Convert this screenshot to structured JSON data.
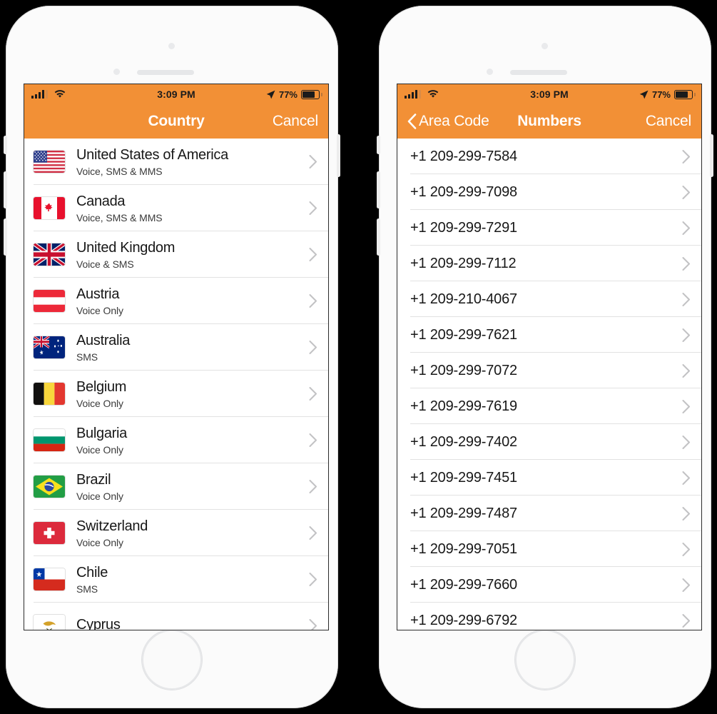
{
  "background_color": "#000000",
  "accent_color": "#f29036",
  "status_bar": {
    "time": "3:09 PM",
    "battery_percent": "77%",
    "signal_icon": "cellular-signal-icon",
    "wifi_icon": "wifi-icon",
    "location_icon": "location-arrow-icon",
    "battery_icon": "battery-icon"
  },
  "left_phone": {
    "nav": {
      "title": "Country",
      "right_label": "Cancel",
      "back_label": ""
    },
    "rows": [
      {
        "flag": "us",
        "name": "United States of America",
        "services": "Voice, SMS & MMS"
      },
      {
        "flag": "ca",
        "name": "Canada",
        "services": "Voice, SMS & MMS"
      },
      {
        "flag": "gb",
        "name": "United Kingdom",
        "services": "Voice & SMS"
      },
      {
        "flag": "at",
        "name": "Austria",
        "services": "Voice Only"
      },
      {
        "flag": "au",
        "name": "Australia",
        "services": "SMS"
      },
      {
        "flag": "be",
        "name": "Belgium",
        "services": "Voice Only"
      },
      {
        "flag": "bg",
        "name": "Bulgaria",
        "services": "Voice Only"
      },
      {
        "flag": "br",
        "name": "Brazil",
        "services": "Voice Only"
      },
      {
        "flag": "ch",
        "name": "Switzerland",
        "services": "Voice Only"
      },
      {
        "flag": "cl",
        "name": "Chile",
        "services": "SMS"
      },
      {
        "flag": "cy",
        "name": "Cyprus",
        "services": ""
      }
    ]
  },
  "right_phone": {
    "nav": {
      "title": "Numbers",
      "right_label": "Cancel",
      "back_label": "Area Code"
    },
    "rows": [
      {
        "number": "+1 209-299-7584"
      },
      {
        "number": "+1 209-299-7098"
      },
      {
        "number": "+1 209-299-7291"
      },
      {
        "number": "+1 209-299-7112"
      },
      {
        "number": "+1 209-210-4067"
      },
      {
        "number": "+1 209-299-7621"
      },
      {
        "number": "+1 209-299-7072"
      },
      {
        "number": "+1 209-299-7619"
      },
      {
        "number": "+1 209-299-7402"
      },
      {
        "number": "+1 209-299-7451"
      },
      {
        "number": "+1 209-299-7487"
      },
      {
        "number": "+1 209-299-7051"
      },
      {
        "number": "+1 209-299-7660"
      },
      {
        "number": "+1 209-299-6792"
      }
    ]
  }
}
